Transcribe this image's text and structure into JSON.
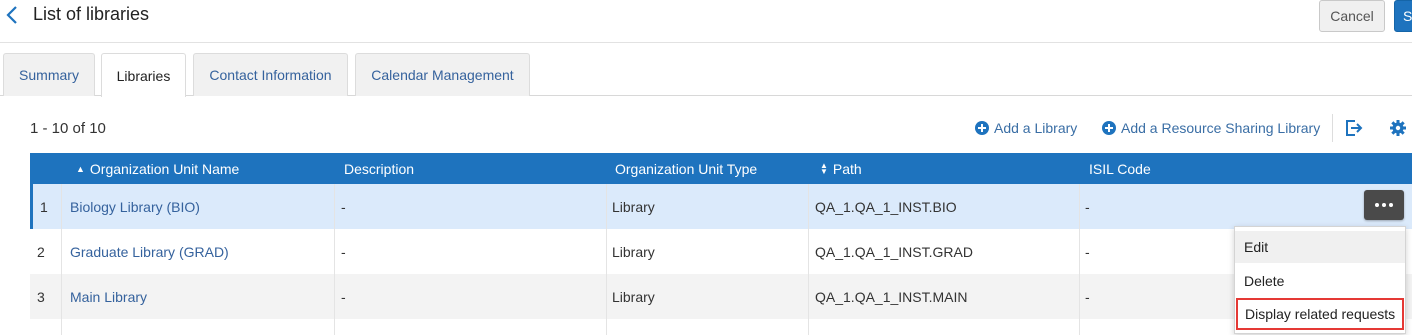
{
  "header": {
    "title": "List of libraries",
    "cancel_label": "Cancel",
    "save_label": "S"
  },
  "tabs": [
    {
      "label": "Summary",
      "active": false
    },
    {
      "label": "Libraries",
      "active": true
    },
    {
      "label": "Contact Information",
      "active": false
    },
    {
      "label": "Calendar Management",
      "active": false
    }
  ],
  "toolbar": {
    "record_count": "1 - 10 of 10",
    "add_library": "Add a Library",
    "add_rs_library": "Add a Resource Sharing Library",
    "export_icon": "export-icon",
    "settings_icon": "gear-icon"
  },
  "table": {
    "columns": [
      "Organization Unit Name",
      "Description",
      "Organization Unit Type",
      "Path",
      "ISIL Code"
    ],
    "sort": {
      "name_col": "ascending",
      "path_col": "sortable"
    },
    "rows": [
      {
        "num": "1",
        "name": "Biology Library (BIO)",
        "description": "-",
        "type": "Library",
        "path": "QA_1.QA_1_INST.BIO",
        "isil": "-"
      },
      {
        "num": "2",
        "name": "Graduate Library (GRAD)",
        "description": "-",
        "type": "Library",
        "path": "QA_1.QA_1_INST.GRAD",
        "isil": "-"
      },
      {
        "num": "3",
        "name": "Main Library",
        "description": "-",
        "type": "Library",
        "path": "QA_1.QA_1_INST.MAIN",
        "isil": "-"
      }
    ]
  },
  "row_menu": {
    "items": [
      "Edit",
      "Delete",
      "Display related requests"
    ],
    "highlighted": "Display related requests"
  },
  "colors": {
    "accent": "#1e73be",
    "link": "#35629d",
    "selected_row": "#dbeafb",
    "highlight_border": "#e53935"
  }
}
